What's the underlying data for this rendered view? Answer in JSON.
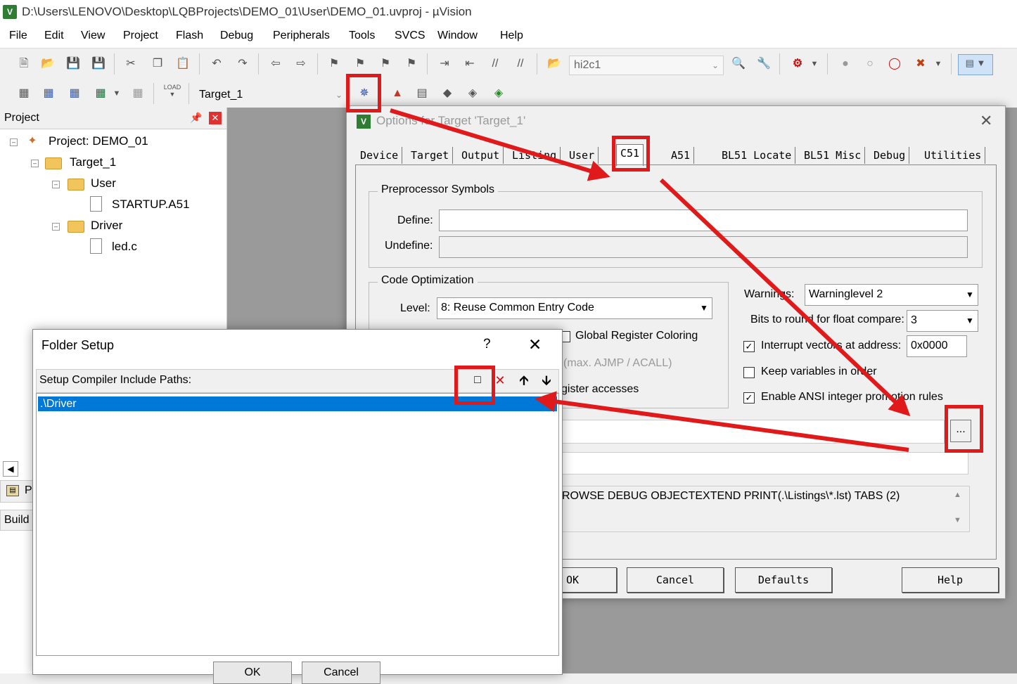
{
  "window": {
    "title": "D:\\Users\\LENOVO\\Desktop\\LQBProjects\\DEMO_01\\User\\DEMO_01.uvproj - µVision",
    "icon": "V"
  },
  "menu": [
    "File",
    "Edit",
    "View",
    "Project",
    "Flash",
    "Debug",
    "Peripherals",
    "Tools",
    "SVCS",
    "Window",
    "Help"
  ],
  "toolbar": {
    "find_combo": "hi2c1",
    "target_combo": "Target_1",
    "load_label": "LOAD"
  },
  "project_panel": {
    "title": "Project",
    "tree": {
      "project": "Project: DEMO_01",
      "target": "Target_1",
      "group_user": "User",
      "file_startup": "STARTUP.A51",
      "group_driver": "Driver",
      "file_led": "led.c"
    },
    "bottom_tab": "P",
    "build_label": "Build"
  },
  "options_dialog": {
    "title": "Options for Target 'Target_1'",
    "tabs": [
      "Device",
      "Target",
      "Output",
      "Listing",
      "User",
      "C51",
      "A51",
      "BL51 Locate",
      "BL51 Misc",
      "Debug",
      "Utilities"
    ],
    "preprocessor": {
      "group_label": "Preprocessor Symbols",
      "define_label": "Define:",
      "define_value": "",
      "undefine_label": "Undefine:",
      "undefine_value": ""
    },
    "code_opt": {
      "group_label": "Code Optimization",
      "level_label": "Level:",
      "level_value": "8: Reuse Common Entry Code",
      "global_reg": "Global Register Coloring",
      "max_ajmp": "(max. AJMP / ACALL)",
      "reg_access": "gister accesses"
    },
    "warnings_label": "Warnings:",
    "warnings_value": "Warninglevel 2",
    "bits_label": "Bits to round for float compare:",
    "bits_value": "3",
    "interrupt_label": "Interrupt vectors at address:",
    "interrupt_value": "0x0000",
    "keep_vars": "Keep variables in order",
    "ansi_rules": "Enable ANSI integer promotion rules",
    "browse_button": "...",
    "misc_controls_text": "ROWSE DEBUG OBJECTEXTEND PRINT(.\\Listings\\*.lst) TABS (2)",
    "buttons": {
      "ok": "OK",
      "cancel": "Cancel",
      "defaults": "Defaults",
      "help": "Help"
    }
  },
  "folder_setup": {
    "title": "Folder Setup",
    "help": "?",
    "close": "✕",
    "list_label": "Setup Compiler Include Paths:",
    "paths": [
      ".\\Driver"
    ],
    "ok": "OK",
    "cancel": "Cancel"
  },
  "annotation_color": "#e01a1a"
}
